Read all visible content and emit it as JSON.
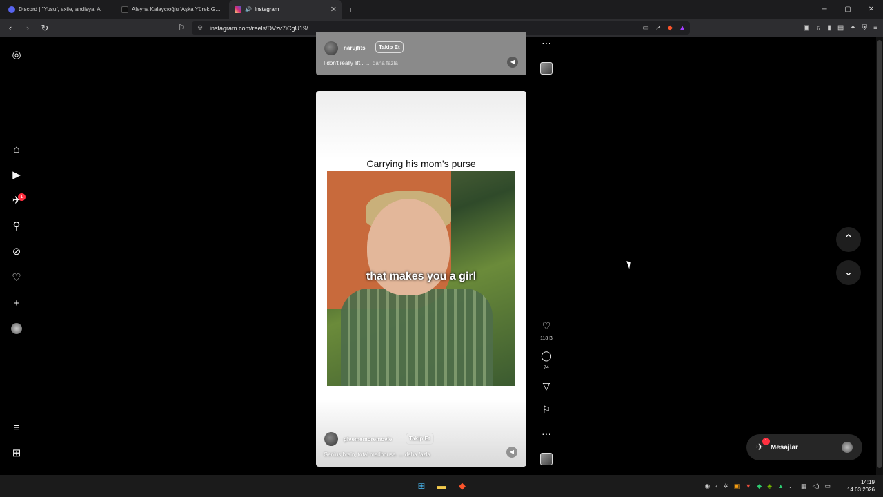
{
  "browser": {
    "tabs": [
      {
        "label": "Discord | \"Yusuf, exile, andisya, A",
        "icon": "discord-icon",
        "active": false,
        "color": "#5865f2"
      },
      {
        "label": "Aleyna Kalaycıoğlu 'Aşka Yürek Gerek",
        "icon": "tiktok-icon",
        "active": false,
        "color": "#222222"
      },
      {
        "label": "Instagram",
        "icon": "instagram-icon",
        "active": true,
        "color": "#d62976"
      }
    ],
    "url": "instagram.com/reels/DVzv7iCgU19/",
    "window_controls": [
      "─",
      "▢",
      "✕"
    ]
  },
  "sidebar": {
    "items": [
      "instagram-logo",
      "home",
      "reels",
      "messages",
      "search",
      "explore",
      "notifications",
      "create",
      "profile",
      "more",
      "also-from-meta"
    ],
    "messages_badge": "1"
  },
  "reel_top": {
    "username": "narujfits",
    "follow_label": "Takip Et",
    "caption": "I don't really lift...",
    "more": "... daha fazla"
  },
  "reel_main": {
    "title": "Carrying his mom's purse",
    "subtitle_in_video": "that makes you a girl",
    "username": "givememoremovie",
    "follow_label": "Takip Et",
    "caption": "Genius brain, total madhouse.",
    "more": "... daha fazla",
    "likes": "118 B",
    "comments": "74"
  },
  "messages_pill": {
    "label": "Mesajlar",
    "badge": "1"
  },
  "taskbar": {
    "time": "14:19",
    "date": "14.03.2026"
  },
  "colors": {
    "accent": "#ff3040",
    "background": "#000000"
  }
}
